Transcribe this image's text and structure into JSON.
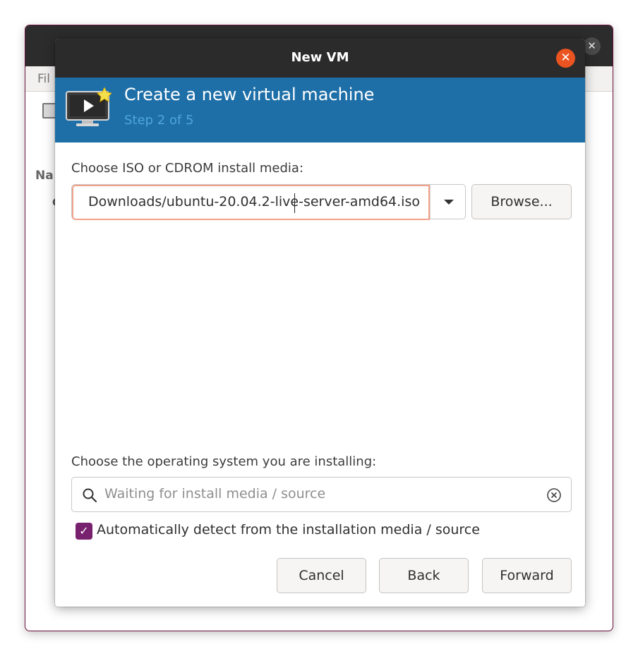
{
  "background_window": {
    "menu_partial": "Fil",
    "label_partial": "Na",
    "label_partial_2": "C",
    "close_glyph": "✕"
  },
  "dialog": {
    "title": "New VM",
    "close_glyph": "✕",
    "header": {
      "title": "Create a new virtual machine",
      "step": "Step 2 of 5",
      "icon": "monitor-play-icon"
    },
    "iso": {
      "label": "Choose ISO or CDROM install media:",
      "value": "Downloads/ubuntu-20.04.2-live-server-amd64.iso",
      "browse_label": "Browse..."
    },
    "os": {
      "label": "Choose the operating system you are installing:",
      "placeholder": "Waiting for install media / source"
    },
    "auto_detect": {
      "checked": true,
      "label": "Automatically detect from the installation media / source"
    },
    "buttons": {
      "cancel": "Cancel",
      "back": "Back",
      "forward": "Forward"
    }
  },
  "colors": {
    "banner": "#1e6fa8",
    "step_text": "#4fa4dd",
    "close_button": "#e95420",
    "checkbox": "#77216f",
    "input_focus_border": "#f1a08a"
  }
}
